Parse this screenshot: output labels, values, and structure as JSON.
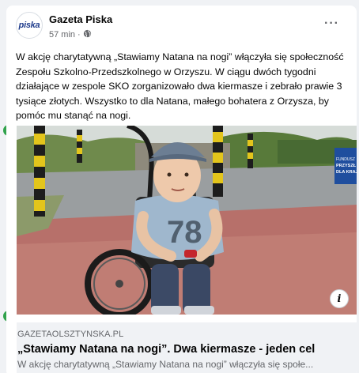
{
  "post": {
    "page_name": "Gazeta Piska",
    "avatar_text": "piska",
    "time": "57 min",
    "separator": "·",
    "more_label": "···",
    "text": "W akcję charytatywną „Stawiamy Natana na nogi” włączyła się społeczność Zespołu Szkolno-Przedszkolnego w Orzyszu. W ciągu dwóch tygodni działające w zespole SKO zorganizowało dwa kiermasze i zebrało prawie 3 tysiące złotych. Wszystko to dla Natana, małego bohatera z Orzysza, by pomóc mu stanąć na nogi."
  },
  "photo": {
    "shirt_number": "78",
    "sign_text": "FUNDUSZ PRZYSZŁ DLA KRAJU",
    "info_label": "i"
  },
  "link_preview": {
    "domain": "GAZETAOLSZTYNSKA.PL",
    "title": "„Stawiamy Natana na nogi”. Dwa kiermasze - jeden cel",
    "description": "W akcję charytatywną „Stawiamy Natana na nogi” włączyła się społe..."
  },
  "colors": {
    "accent_green": "#31a24c",
    "secondary_text": "#65676b",
    "link_box_bg": "#f0f2f5"
  },
  "icons": [
    "globe-icon",
    "more-options-icon",
    "info-icon",
    "check-icon"
  ]
}
